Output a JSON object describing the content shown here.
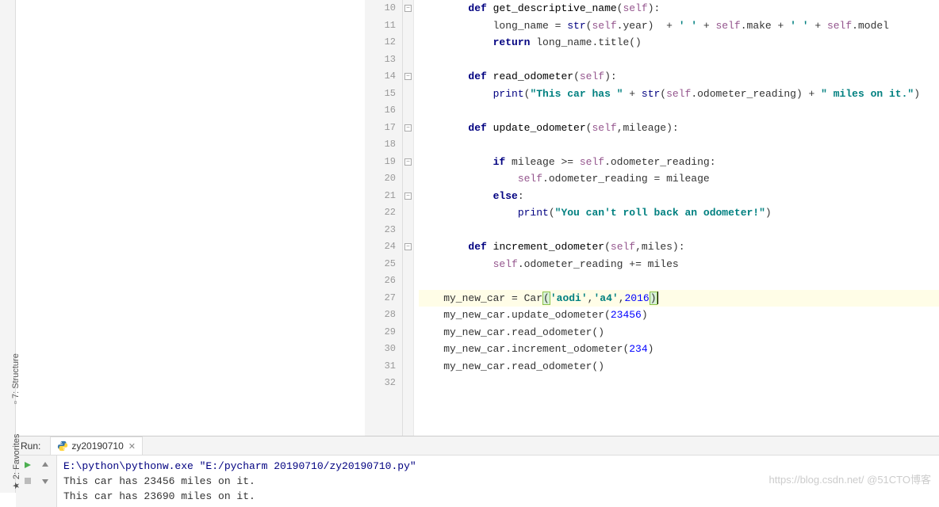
{
  "sidebar": {
    "structure_label": "7: Structure",
    "favorites_label": "2: Favorites"
  },
  "gutter": {
    "start": 10,
    "end": 32
  },
  "code": {
    "lines": [
      {
        "n": 10,
        "indent": "        ",
        "tokens": [
          {
            "t": "kw",
            "v": "def"
          },
          {
            "t": "",
            "v": " "
          },
          {
            "t": "fn",
            "v": "get_descriptive_name"
          },
          {
            "t": "",
            "v": "("
          },
          {
            "t": "self",
            "v": "self"
          },
          {
            "t": "",
            "v": "):"
          }
        ]
      },
      {
        "n": 11,
        "indent": "            ",
        "tokens": [
          {
            "t": "",
            "v": "long_name = "
          },
          {
            "t": "builtin",
            "v": "str"
          },
          {
            "t": "",
            "v": "("
          },
          {
            "t": "self",
            "v": "self"
          },
          {
            "t": "",
            "v": ".year)  + "
          },
          {
            "t": "str",
            "v": "' '"
          },
          {
            "t": "",
            "v": " + "
          },
          {
            "t": "self",
            "v": "self"
          },
          {
            "t": "",
            "v": ".make + "
          },
          {
            "t": "str",
            "v": "' '"
          },
          {
            "t": "",
            "v": " + "
          },
          {
            "t": "self",
            "v": "self"
          },
          {
            "t": "",
            "v": ".model"
          }
        ]
      },
      {
        "n": 12,
        "indent": "            ",
        "tokens": [
          {
            "t": "kw",
            "v": "return"
          },
          {
            "t": "",
            "v": " long_name.title()"
          }
        ]
      },
      {
        "n": 13,
        "indent": "",
        "tokens": []
      },
      {
        "n": 14,
        "indent": "        ",
        "tokens": [
          {
            "t": "kw",
            "v": "def"
          },
          {
            "t": "",
            "v": " "
          },
          {
            "t": "fn",
            "v": "read_odometer"
          },
          {
            "t": "",
            "v": "("
          },
          {
            "t": "self",
            "v": "self"
          },
          {
            "t": "",
            "v": "):"
          }
        ]
      },
      {
        "n": 15,
        "indent": "            ",
        "tokens": [
          {
            "t": "builtin",
            "v": "print"
          },
          {
            "t": "",
            "v": "("
          },
          {
            "t": "str",
            "v": "\"This car has \""
          },
          {
            "t": "",
            "v": " + "
          },
          {
            "t": "builtin",
            "v": "str"
          },
          {
            "t": "",
            "v": "("
          },
          {
            "t": "self",
            "v": "self"
          },
          {
            "t": "",
            "v": ".odometer_reading) + "
          },
          {
            "t": "str",
            "v": "\" miles on it.\""
          },
          {
            "t": "",
            "v": ")"
          }
        ]
      },
      {
        "n": 16,
        "indent": "",
        "tokens": []
      },
      {
        "n": 17,
        "indent": "        ",
        "tokens": [
          {
            "t": "kw",
            "v": "def"
          },
          {
            "t": "",
            "v": " "
          },
          {
            "t": "fn",
            "v": "update_odometer"
          },
          {
            "t": "",
            "v": "("
          },
          {
            "t": "self",
            "v": "self"
          },
          {
            "t": "",
            "v": ",mileage):"
          }
        ]
      },
      {
        "n": 18,
        "indent": "",
        "tokens": []
      },
      {
        "n": 19,
        "indent": "            ",
        "tokens": [
          {
            "t": "kw",
            "v": "if"
          },
          {
            "t": "",
            "v": " mileage >= "
          },
          {
            "t": "self",
            "v": "self"
          },
          {
            "t": "",
            "v": ".odometer_reading:"
          }
        ]
      },
      {
        "n": 20,
        "indent": "                ",
        "tokens": [
          {
            "t": "self",
            "v": "self"
          },
          {
            "t": "",
            "v": ".odometer_reading = mileage"
          }
        ]
      },
      {
        "n": 21,
        "indent": "            ",
        "tokens": [
          {
            "t": "kw",
            "v": "else"
          },
          {
            "t": "",
            "v": ":"
          }
        ]
      },
      {
        "n": 22,
        "indent": "                ",
        "tokens": [
          {
            "t": "builtin",
            "v": "print"
          },
          {
            "t": "",
            "v": "("
          },
          {
            "t": "str",
            "v": "\"You can't roll back an odometer!\""
          },
          {
            "t": "",
            "v": ")"
          }
        ]
      },
      {
        "n": 23,
        "indent": "",
        "tokens": []
      },
      {
        "n": 24,
        "indent": "        ",
        "tokens": [
          {
            "t": "kw",
            "v": "def"
          },
          {
            "t": "",
            "v": " "
          },
          {
            "t": "fn",
            "v": "increment_odometer"
          },
          {
            "t": "",
            "v": "("
          },
          {
            "t": "self",
            "v": "self"
          },
          {
            "t": "",
            "v": ",miles):"
          }
        ]
      },
      {
        "n": 25,
        "indent": "            ",
        "tokens": [
          {
            "t": "self",
            "v": "self"
          },
          {
            "t": "",
            "v": ".odometer_reading += miles"
          }
        ]
      },
      {
        "n": 26,
        "indent": "",
        "tokens": []
      },
      {
        "n": 27,
        "indent": "    ",
        "hl": true,
        "tokens": [
          {
            "t": "",
            "v": "my_new_car = Car"
          },
          {
            "t": "paren",
            "v": "("
          },
          {
            "t": "str",
            "v": "'aodi'"
          },
          {
            "t": "",
            "v": ","
          },
          {
            "t": "str",
            "v": "'a4'"
          },
          {
            "t": "",
            "v": ","
          },
          {
            "t": "num",
            "v": "2016"
          },
          {
            "t": "paren",
            "v": ")"
          },
          {
            "t": "cursor",
            "v": ""
          }
        ]
      },
      {
        "n": 28,
        "indent": "    ",
        "tokens": [
          {
            "t": "",
            "v": "my_new_car.update_odometer("
          },
          {
            "t": "num",
            "v": "23456"
          },
          {
            "t": "",
            "v": ")"
          }
        ]
      },
      {
        "n": 29,
        "indent": "    ",
        "tokens": [
          {
            "t": "",
            "v": "my_new_car.read_odometer()"
          }
        ]
      },
      {
        "n": 30,
        "indent": "    ",
        "tokens": [
          {
            "t": "",
            "v": "my_new_car.increment_odometer("
          },
          {
            "t": "num",
            "v": "234"
          },
          {
            "t": "",
            "v": ")"
          }
        ]
      },
      {
        "n": 31,
        "indent": "    ",
        "tokens": [
          {
            "t": "",
            "v": "my_new_car.read_odometer()"
          }
        ]
      },
      {
        "n": 32,
        "indent": "",
        "tokens": []
      }
    ]
  },
  "run": {
    "label": "Run:",
    "tab_name": "zy20190710"
  },
  "console": {
    "cmd": "E:\\python\\pythonw.exe \"E:/pycharm 20190710/zy20190710.py\"",
    "out1": "This car has 23456 miles on it.",
    "out2": "This car has 23690 miles on it."
  },
  "watermark": "https://blog.csdn.net/  @51CTO博客"
}
